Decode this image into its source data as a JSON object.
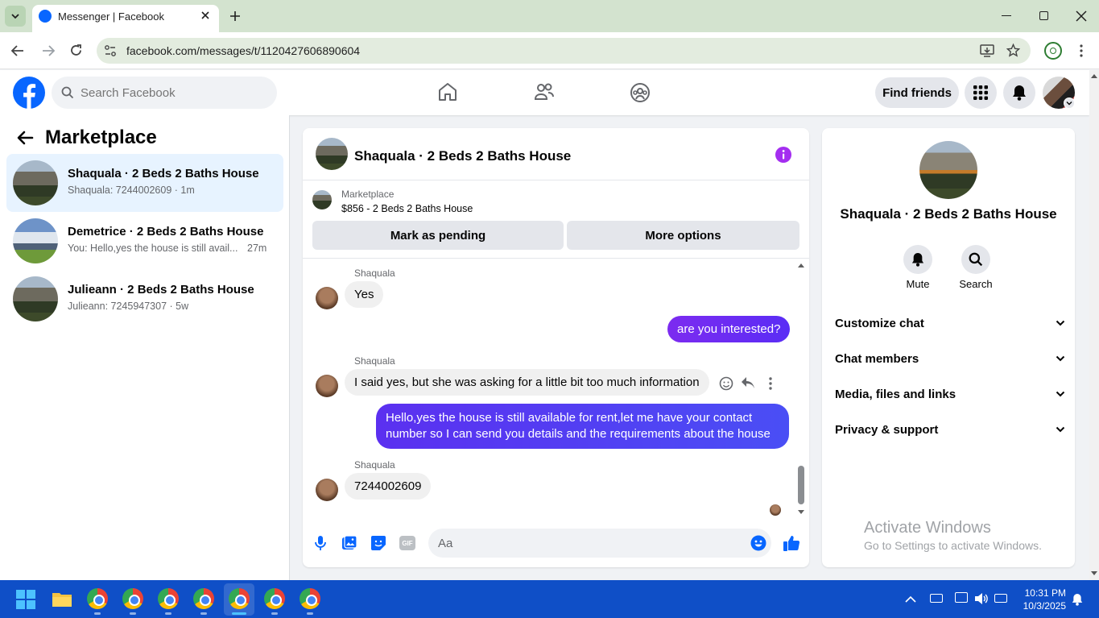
{
  "browser": {
    "tab_title": "Messenger | Facebook",
    "url": "facebook.com/messages/t/1120427606890604"
  },
  "header": {
    "search_placeholder": "Search Facebook",
    "find_friends": "Find friends"
  },
  "sidebar": {
    "title": "Marketplace",
    "conversations": [
      {
        "title": "Shaqualа · 2 Beds 2 Baths House",
        "subtitle": "Shaqualа: 7244002609 · 1m",
        "time": "",
        "active": true
      },
      {
        "title": "Demetrice · 2 Beds 2 Baths House",
        "subtitle": "You: Hello,yes the house is still avail...",
        "time": "27m",
        "active": false
      },
      {
        "title": "Julieann · 2 Beds 2 Baths House",
        "subtitle": "Julieann: 7245947307 · 5w",
        "time": "",
        "active": false
      }
    ]
  },
  "chat": {
    "title": "Shaqualа · 2 Beds 2 Baths House",
    "marketplace_label": "Marketplace",
    "listing": "$856 - 2 Beds 2 Baths House",
    "mark_pending": "Mark as pending",
    "more_options": "More options",
    "messages": [
      {
        "sender": "Shaqualа",
        "text": "Yes",
        "direction": "in"
      },
      {
        "text": "are you interested?",
        "direction": "out"
      },
      {
        "sender": "Shaqualа",
        "text": "I said yes, but she was asking for a little bit too much information",
        "direction": "in"
      },
      {
        "text": "Hello,yes the house is still available for rent,let me have your contact number so I can send you details and the requirements about the house",
        "direction": "out"
      },
      {
        "sender": "Shaqualа",
        "text": "7244002609",
        "direction": "in"
      }
    ],
    "composer_placeholder": "Aa",
    "gif_label": "GIF"
  },
  "details": {
    "name": "Shaqualа · 2 Beds 2 Baths House",
    "mute": "Mute",
    "search": "Search",
    "sections": [
      "Customize chat",
      "Chat members",
      "Media, files and links",
      "Privacy & support"
    ]
  },
  "watermark": {
    "line1": "Activate Windows",
    "line2": "Go to Settings to activate Windows."
  },
  "taskbar": {
    "time": "10:31 PM",
    "date": "10/3/2025"
  },
  "colors": {
    "fb_blue": "#0866ff",
    "messenger_purple": "#7c2bf0",
    "active_row": "#e7f3ff"
  }
}
